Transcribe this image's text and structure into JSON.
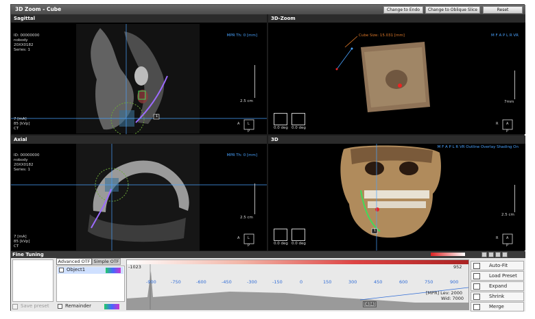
{
  "window": {
    "title": "3D Zoom - Cube",
    "buttons": [
      "Change to Endo",
      "Change to Oblique Slice",
      "Reset"
    ]
  },
  "viewports": {
    "sagittal": {
      "label": "Sagittal",
      "info_top": "ID: 00000000\nnobody\n20XX0182\nSeries: 1",
      "info_bottom": "7 [mA]\n85 [kVp]\nCT",
      "right_info": "MPR\nTh: 0 [mm]",
      "scale_label": "2.5 cm",
      "marker": "1"
    },
    "zoom3d": {
      "label": "3D-Zoom",
      "right_info": "M F A P L R\nVR",
      "cube_size": "Cube Size: 15.031 [mm]",
      "scale_label": "7mm",
      "angle1": "0.0 deg",
      "angle2": "0.0 deg"
    },
    "axial": {
      "label": "Axial",
      "info_top": "ID: 00000000\nnobody\n20XX0182\nSeries: 1",
      "info_bottom": "7 [mA]\n85 [kVp]\nCT",
      "right_info": "MPR\nTh: 0 [mm]",
      "scale_label": "2.5 cm"
    },
    "vr3d": {
      "label": "3D",
      "right_info": "M F A P L R\nVR\nOutline Overlay\nShading On",
      "scale_label": "2.5 cm",
      "angle1": "0.0 deg",
      "angle2": "0.0 deg",
      "marker": "1"
    }
  },
  "orientation": {
    "sagittal": [
      "A",
      "L",
      "P"
    ],
    "zoom3d": [
      "R",
      "A",
      "P"
    ],
    "axial": [
      "A",
      "L",
      "P"
    ],
    "vr3d": [
      "R",
      "A",
      "P"
    ]
  },
  "bottom_panel": {
    "fine_tuning": "Fine Tuning",
    "tabs": [
      "Advanced OTF",
      "Simple OTF"
    ],
    "object1": "Object1",
    "remainder": "Remainder",
    "save_preset": "Save preset",
    "histogram": {
      "min_label": "-1023",
      "max_label": "952",
      "ticks": [
        "-900",
        "-750",
        "-600",
        "-450",
        "-300",
        "-150",
        "0",
        "150",
        "300",
        "450",
        "600",
        "750",
        "900"
      ],
      "mpr_level": "[MPR] Lev: 2000",
      "mpr_width": "Wid: 7000",
      "cursor_value": "[434]"
    },
    "side_buttons": [
      "Auto-Fit",
      "Load Preset",
      "Expand",
      "Shrink",
      "Merge"
    ]
  },
  "colors": {
    "accent_blue": "#4aa3ff",
    "bone": "#c8a874",
    "curve": "#9d6bff"
  }
}
